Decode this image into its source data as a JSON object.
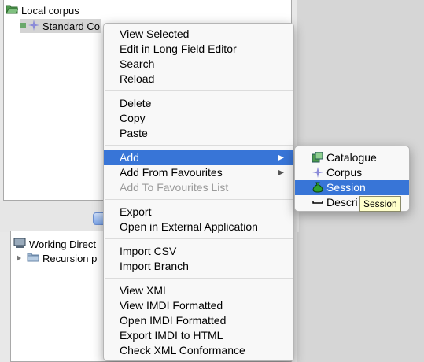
{
  "tree_top": {
    "root_label": "Local corpus",
    "child_label": "Standard Co"
  },
  "tree_bottom": {
    "root_label": "Working Direct",
    "child_label": "Recursion p"
  },
  "context_menu": {
    "items": [
      {
        "label": "View Selected",
        "enabled": true
      },
      {
        "label": "Edit in Long Field Editor",
        "enabled": true
      },
      {
        "label": "Search",
        "enabled": true
      },
      {
        "label": "Reload",
        "enabled": true
      },
      {
        "label": "Delete",
        "enabled": true
      },
      {
        "label": "Copy",
        "enabled": true
      },
      {
        "label": "Paste",
        "enabled": true
      },
      {
        "label": "Add",
        "enabled": true,
        "highlighted": true,
        "submenu": true
      },
      {
        "label": "Add From Favourites",
        "enabled": true,
        "submenu": true
      },
      {
        "label": "Add To Favourites List",
        "enabled": false
      },
      {
        "label": "Export",
        "enabled": true
      },
      {
        "label": "Open in External Application",
        "enabled": true
      },
      {
        "label": "Import CSV",
        "enabled": true
      },
      {
        "label": "Import Branch",
        "enabled": true
      },
      {
        "label": "View XML",
        "enabled": true
      },
      {
        "label": "View IMDI Formatted",
        "enabled": true
      },
      {
        "label": "Open IMDI Formatted",
        "enabled": true
      },
      {
        "label": "Export IMDI to HTML",
        "enabled": true
      },
      {
        "label": "Check XML Conformance",
        "enabled": true
      }
    ]
  },
  "add_submenu": {
    "items": [
      {
        "label": "Catalogue",
        "icon": "catalogue-icon"
      },
      {
        "label": "Corpus",
        "icon": "corpus-icon"
      },
      {
        "label": "Session",
        "icon": "session-icon",
        "highlighted": true
      },
      {
        "label": "Descri",
        "icon": "description-icon"
      }
    ]
  },
  "tooltip": {
    "text": "Session"
  },
  "colors": {
    "highlight": "#3875d7",
    "folder_green": "#3a7d3a",
    "tooltip_bg": "#ffffca"
  }
}
